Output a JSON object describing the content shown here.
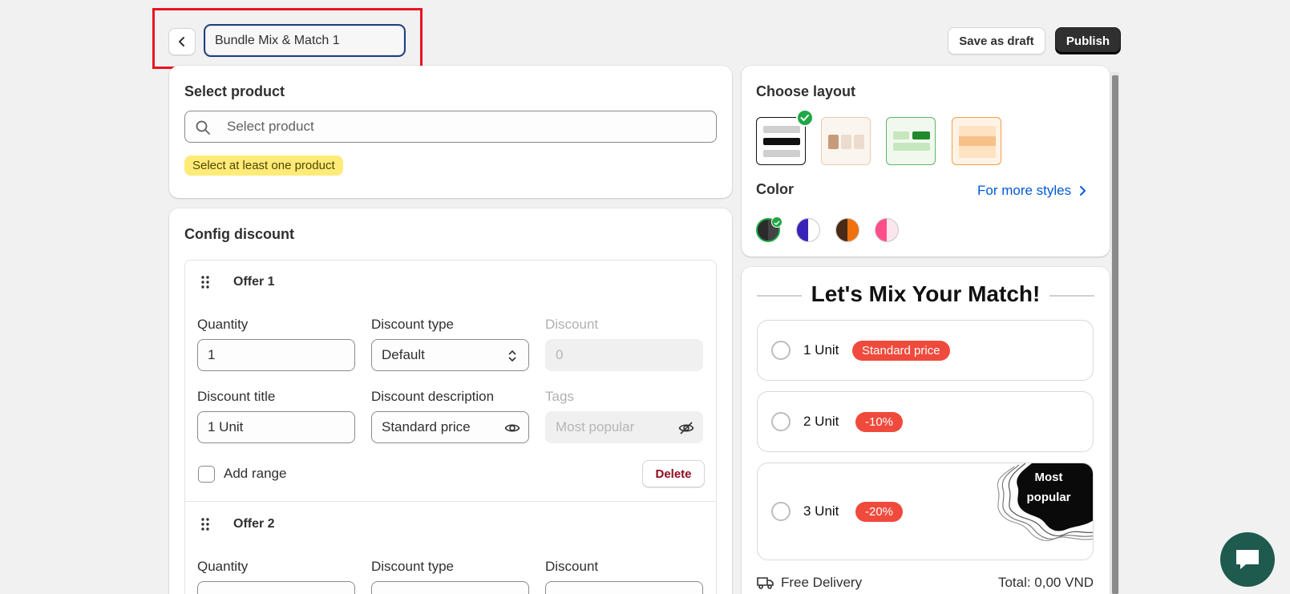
{
  "header": {
    "title_value": "Bundle Mix & Match 1",
    "save_draft_label": "Save as draft",
    "publish_label": "Publish"
  },
  "select_product": {
    "title": "Select product",
    "search_placeholder": "Select product",
    "warning": "Select at least one product"
  },
  "config_discount": {
    "title": "Config discount",
    "offers": [
      {
        "title": "Offer 1",
        "quantity_label": "Quantity",
        "quantity_value": "1",
        "discount_type_label": "Discount type",
        "discount_type_value": "Default",
        "discount_label": "Discount",
        "discount_value": "0",
        "discount_title_label": "Discount title",
        "discount_title_value": "1 Unit",
        "discount_description_label": "Discount description",
        "discount_description_value": "Standard price",
        "tags_label": "Tags",
        "tags_placeholder": "Most popular",
        "add_range_label": "Add range",
        "delete_label": "Delete"
      },
      {
        "title": "Offer 2",
        "quantity_label": "Quantity",
        "discount_type_label": "Discount type",
        "discount_label": "Discount"
      }
    ]
  },
  "layout": {
    "title": "Choose layout",
    "color_label": "Color",
    "more_styles_link": "For more styles",
    "accent_selected": "#1fa845"
  },
  "preview": {
    "heading": "Let's Mix Your Match!",
    "options": [
      {
        "label": "1 Unit",
        "badge": "Standard price"
      },
      {
        "label": "2 Unit",
        "badge": "-10%"
      },
      {
        "label": "3 Unit",
        "badge": "-20%",
        "ribbon_line1": "Most",
        "ribbon_line2": "popular"
      }
    ],
    "free_delivery": "Free Delivery",
    "total": "Total: 0,00 VND",
    "badge_color": "#ef4a3c"
  }
}
